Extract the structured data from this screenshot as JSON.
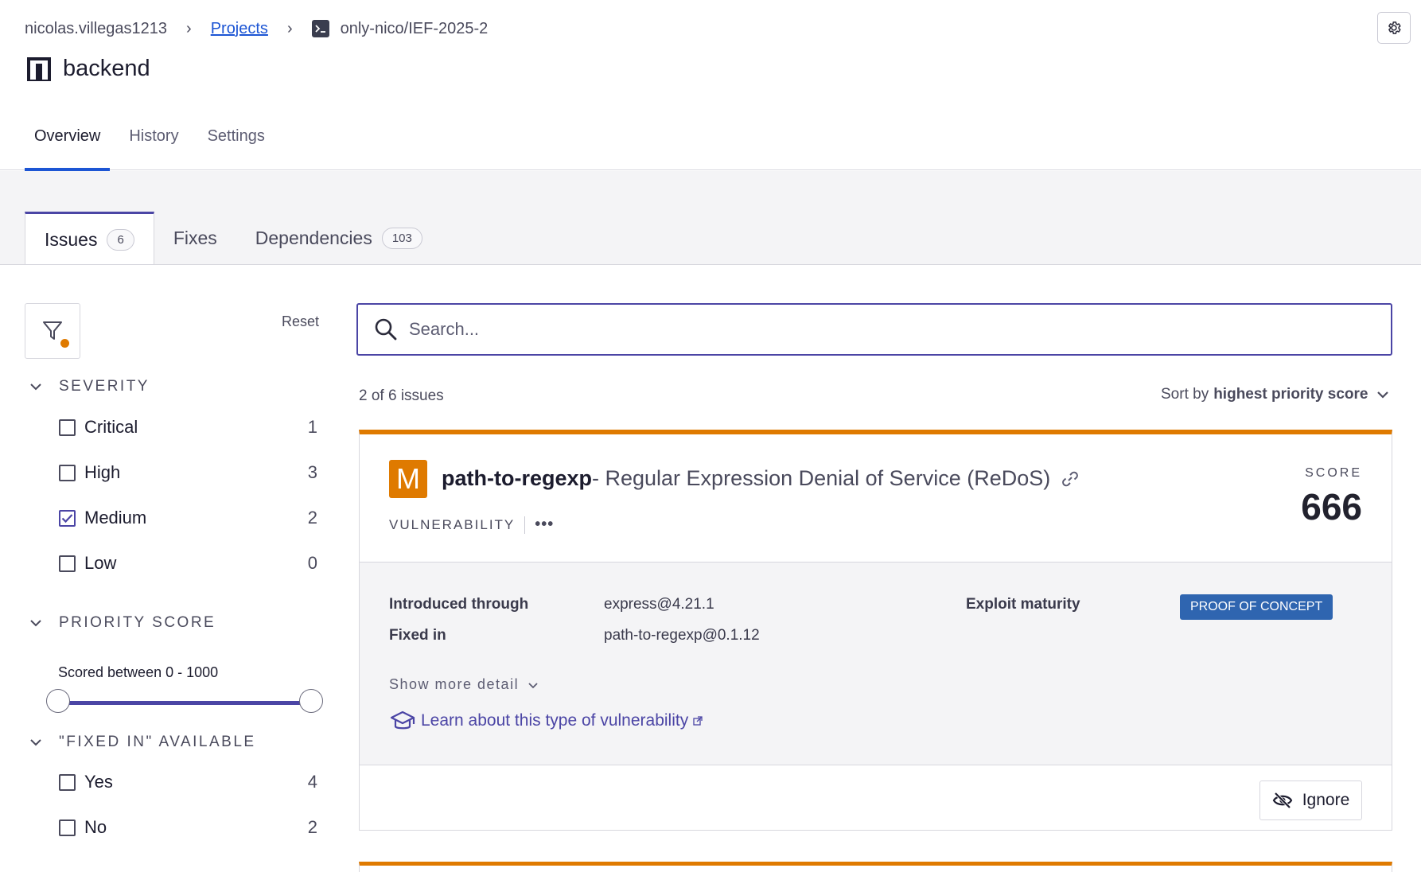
{
  "breadcrumb": {
    "user": "nicolas.villegas1213",
    "projects_link": "Projects",
    "target": "only-nico/IEF-2025-2",
    "separator": "›"
  },
  "project": {
    "name": "backend"
  },
  "main_tabs": [
    {
      "label": "Overview",
      "active": true
    },
    {
      "label": "History",
      "active": false
    },
    {
      "label": "Settings",
      "active": false
    }
  ],
  "sub_tabs": [
    {
      "label": "Issues",
      "count": "6",
      "active": true
    },
    {
      "label": "Fixes",
      "count": null,
      "active": false
    },
    {
      "label": "Dependencies",
      "count": "103",
      "active": false
    }
  ],
  "filters": {
    "reset_label": "Reset",
    "severity": {
      "title": "SEVERITY",
      "options": [
        {
          "label": "Critical",
          "count": "1",
          "checked": false
        },
        {
          "label": "High",
          "count": "3",
          "checked": false
        },
        {
          "label": "Medium",
          "count": "2",
          "checked": true
        },
        {
          "label": "Low",
          "count": "0",
          "checked": false
        }
      ]
    },
    "priority_score": {
      "title": "PRIORITY SCORE",
      "range_text": "Scored between 0 - 1000",
      "min": 0,
      "max": 1000
    },
    "fixed_in": {
      "title": "\"FIXED IN\" AVAILABLE",
      "options": [
        {
          "label": "Yes",
          "count": "4",
          "checked": false
        },
        {
          "label": "No",
          "count": "2",
          "checked": false
        }
      ]
    }
  },
  "search": {
    "placeholder": "Search..."
  },
  "results": {
    "count_text": "2 of 6 issues",
    "sort_prefix": "Sort by",
    "sort_value": "highest priority score"
  },
  "issue": {
    "severity_letter": "M",
    "package": "path-to-regexp",
    "title": "- Regular Expression Denial of Service (ReDoS)",
    "type": "VULNERABILITY",
    "more": "•••",
    "score_label": "SCORE",
    "score": "666",
    "introduced_label": "Introduced through",
    "introduced_value": "express@4.21.1",
    "fixed_label": "Fixed in",
    "fixed_value": "path-to-regexp@0.1.12",
    "exploit_label": "Exploit maturity",
    "exploit_value": "PROOF OF CONCEPT",
    "show_more": "Show more detail",
    "learn_link": "Learn about this type of vulnerability",
    "ignore_label": "Ignore"
  },
  "colors": {
    "accent": "#4b45a5",
    "link": "#1c55d4",
    "medium": "#df7a00",
    "maturity": "#2f65b0"
  },
  "icons": {
    "settings": "gear-icon",
    "terminal": "terminal-icon",
    "project": "project-logo-icon",
    "filter": "filter-icon",
    "search": "search-icon",
    "link": "link-icon",
    "learn": "graduation-cap-icon",
    "ignore": "eye-off-icon"
  }
}
